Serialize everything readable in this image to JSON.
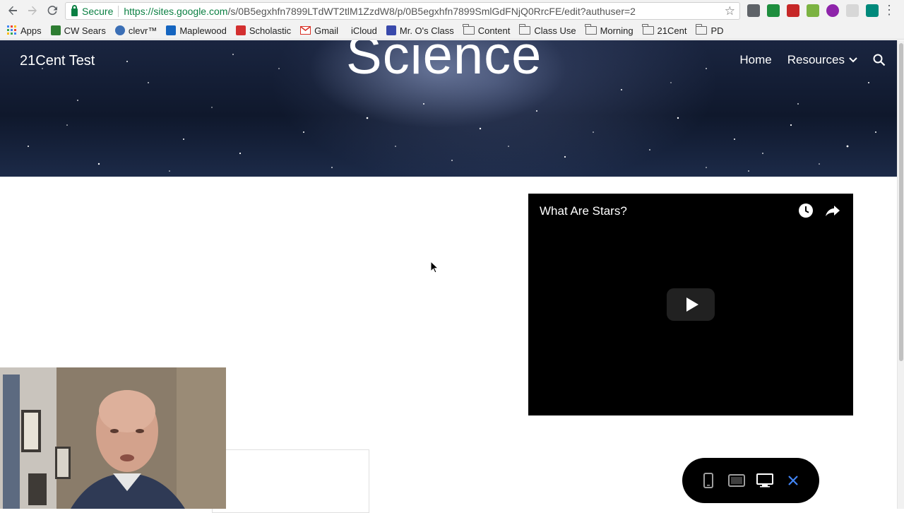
{
  "browser": {
    "secure_label": "Secure",
    "url_domain": "https://sites.google.com",
    "url_path": "/s/0B5egxhfn7899LTdWT2tlM1ZzdW8/p/0B5egxhfn7899SmlGdFNjQ0RrcFE/edit?authuser=2"
  },
  "bookmarks": [
    {
      "label": "Apps",
      "icon": "apps-grid-icon",
      "color": "#4285f4"
    },
    {
      "label": "CW Sears",
      "icon": "cw-sears-icon",
      "color": "#2e7d32"
    },
    {
      "label": "clevr™",
      "icon": "clever-icon",
      "color": "#3b6fb6"
    },
    {
      "label": "Maplewood",
      "icon": "maplewood-icon",
      "color": "#1565c0"
    },
    {
      "label": "Scholastic",
      "icon": "scholastic-icon",
      "color": "#d32f2f"
    },
    {
      "label": "Gmail",
      "icon": "gmail-icon",
      "color": "#d93025"
    },
    {
      "label": "iCloud",
      "icon": "apple-icon",
      "color": "#333333"
    },
    {
      "label": "Mr. O's Class",
      "icon": "class-icon",
      "color": "#3949ab"
    },
    {
      "label": "Content",
      "icon": "folder-icon"
    },
    {
      "label": "Class Use",
      "icon": "folder-icon"
    },
    {
      "label": "Morning",
      "icon": "folder-icon"
    },
    {
      "label": "21Cent",
      "icon": "folder-icon"
    },
    {
      "label": "PD",
      "icon": "folder-icon"
    }
  ],
  "site": {
    "title": "21Cent Test",
    "hero_heading": "Science",
    "nav": {
      "home": "Home",
      "resources": "Resources"
    }
  },
  "video": {
    "title": "What Are Stars?"
  },
  "colors": {
    "secure_green": "#0b8043",
    "hero_dark": "#0f182c",
    "video_bg": "#000000",
    "preview_close": "#4285f4"
  }
}
